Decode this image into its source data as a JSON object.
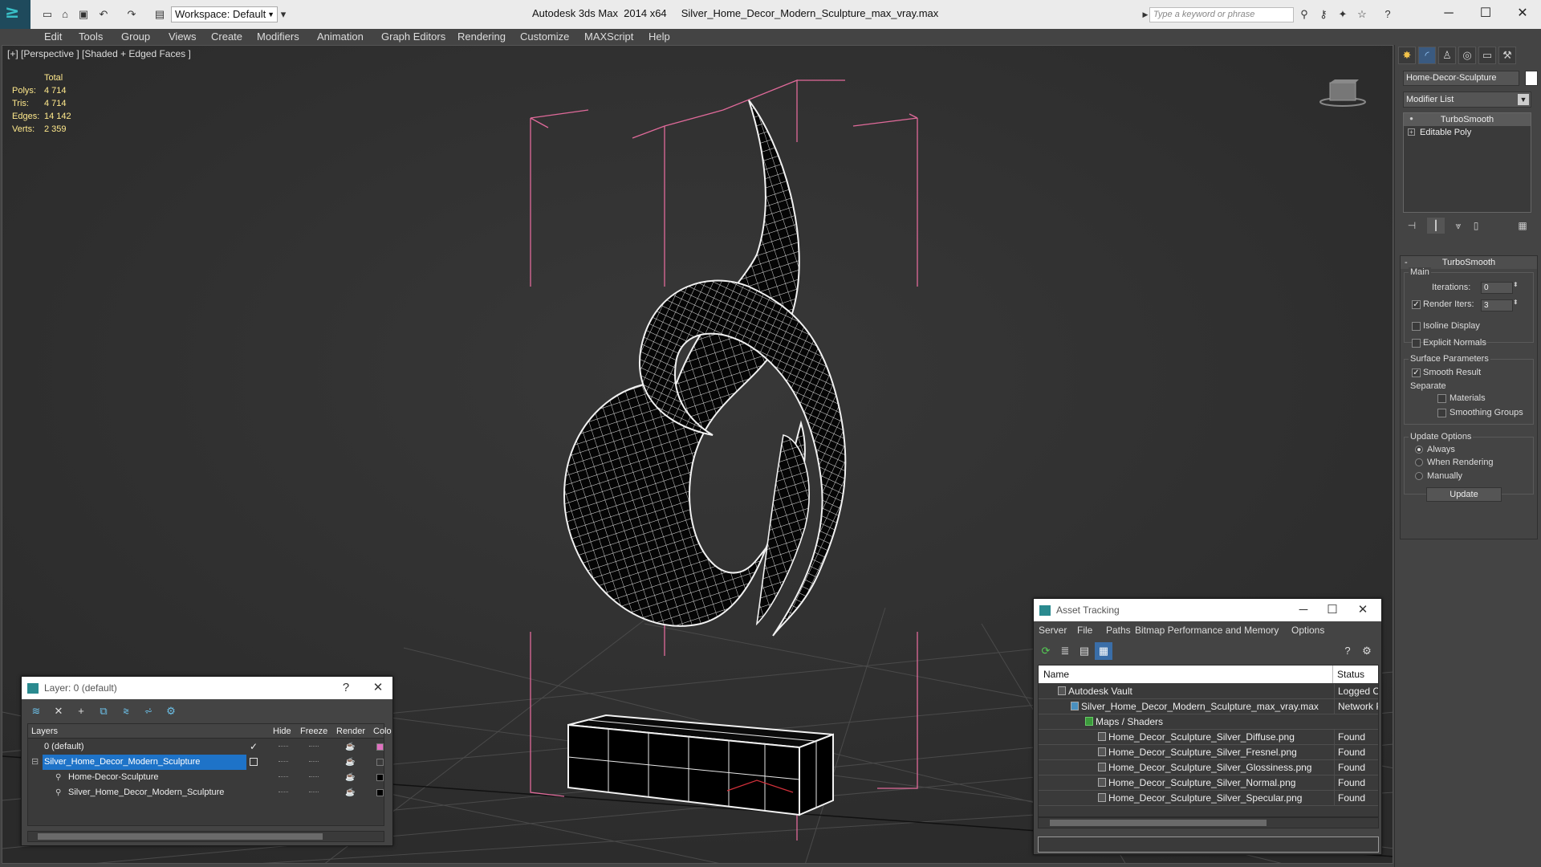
{
  "titlebar": {
    "workspace": "Workspace: Default",
    "app_title": "Autodesk 3ds Max  2014 x64     Silver_Home_Decor_Modern_Sculpture_max_vray.max",
    "search_placeholder": "Type a keyword or phrase"
  },
  "menu": [
    "Edit",
    "Tools",
    "Group",
    "Views",
    "Create",
    "Modifiers",
    "Animation",
    "Graph Editors",
    "Rendering",
    "Customize",
    "MAXScript",
    "Help"
  ],
  "viewport": {
    "label": "[+] [Perspective ] [Shaded + Edged Faces ]",
    "stats": {
      "header": "Total",
      "polys_label": "Polys:",
      "polys": "4 714",
      "tris_label": "Tris:",
      "tris": "4 714",
      "edges_label": "Edges:",
      "edges": "14 142",
      "verts_label": "Verts:",
      "verts": "2 359"
    }
  },
  "command_panel": {
    "object_name": "Home-Decor-Sculpture",
    "modifier_list": "Modifier List",
    "stack": [
      "TurboSmooth",
      "Editable Poly"
    ],
    "rollout": {
      "title": "TurboSmooth",
      "main": "Main",
      "iterations_label": "Iterations:",
      "iterations": "0",
      "render_iters_label": "Render Iters:",
      "render_iters": "3",
      "isoline": "Isoline Display",
      "explicit": "Explicit Normals",
      "surface": "Surface Parameters",
      "smooth_result": "Smooth Result",
      "separate": "Separate",
      "materials": "Materials",
      "smoothing_groups": "Smoothing Groups",
      "update_options": "Update Options",
      "always": "Always",
      "when_rendering": "When Rendering",
      "manually": "Manually",
      "update_button": "Update"
    }
  },
  "layer_window": {
    "title": "Layer: 0 (default)",
    "help": "?",
    "columns": [
      "Layers",
      "Hide",
      "Freeze",
      "Render",
      "Colo"
    ],
    "rows": [
      {
        "name": "0 (default)",
        "color": "#e070c0"
      },
      {
        "name": "Silver_Home_Decor_Modern_Sculpture",
        "color": "#3a3a3a"
      },
      {
        "name": "Home-Decor-Sculpture",
        "color": "#000000"
      },
      {
        "name": "Silver_Home_Decor_Modern_Sculpture",
        "color": "#000000"
      }
    ]
  },
  "asset_tracking": {
    "title": "Asset Tracking",
    "menu": [
      "Server",
      "File",
      "Paths",
      "Bitmap Performance and Memory",
      "Options"
    ],
    "columns": [
      "Name",
      "Status"
    ],
    "rows": [
      {
        "name": "Autodesk Vault",
        "status": "Logged Ou"
      },
      {
        "name": "Silver_Home_Decor_Modern_Sculpture_max_vray.max",
        "status": "Network P"
      },
      {
        "name": "Maps / Shaders",
        "status": ""
      },
      {
        "name": "Home_Decor_Sculpture_Silver_Diffuse.png",
        "status": "Found"
      },
      {
        "name": "Home_Decor_Sculpture_Silver_Fresnel.png",
        "status": "Found"
      },
      {
        "name": "Home_Decor_Sculpture_Silver_Glossiness.png",
        "status": "Found"
      },
      {
        "name": "Home_Decor_Sculpture_Silver_Normal.png",
        "status": "Found"
      },
      {
        "name": "Home_Decor_Sculpture_Silver_Specular.png",
        "status": "Found"
      }
    ]
  }
}
